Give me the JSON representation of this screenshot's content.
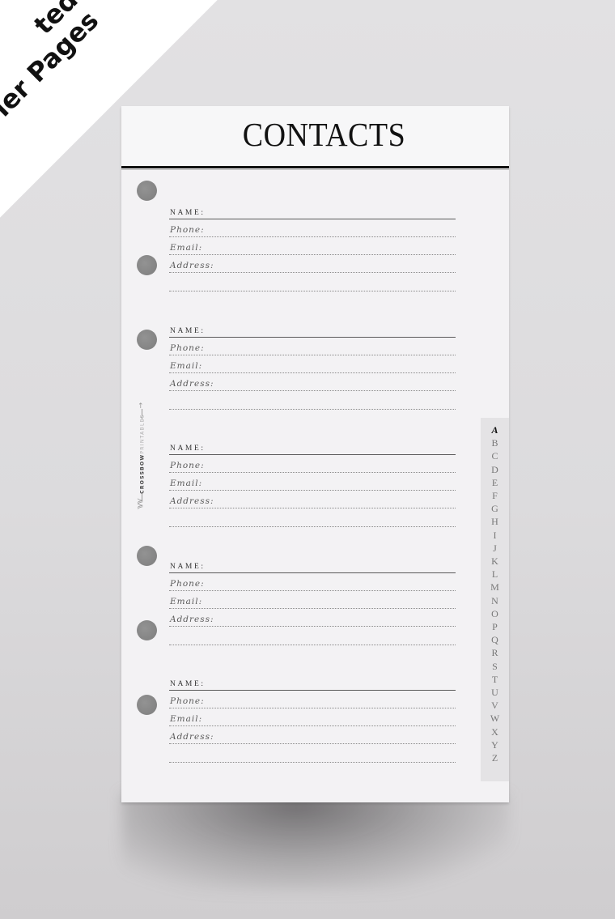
{
  "badge": {
    "line1": "ted",
    "line2": "ler Pages"
  },
  "page": {
    "title": "CONTACTS",
    "entries": [
      {
        "name_label": "NAME:",
        "phone_label": "Phone:",
        "email_label": "Email:",
        "address_label": "Address:"
      },
      {
        "name_label": "NAME:",
        "phone_label": "Phone:",
        "email_label": "Email:",
        "address_label": "Address:"
      },
      {
        "name_label": "NAME:",
        "phone_label": "Phone:",
        "email_label": "Email:",
        "address_label": "Address:"
      },
      {
        "name_label": "NAME:",
        "phone_label": "Phone:",
        "email_label": "Email:",
        "address_label": "Address:"
      },
      {
        "name_label": "NAME:",
        "phone_label": "Phone:",
        "email_label": "Email:",
        "address_label": "Address:"
      }
    ],
    "brand": {
      "bold": "CROSSBOW",
      "light": "PRINTABLES"
    },
    "tabs": {
      "active": "A",
      "letters": [
        "A",
        "B",
        "C",
        "D",
        "E",
        "F",
        "G",
        "H",
        "I",
        "J",
        "K",
        "L",
        "M",
        "N",
        "O",
        "P",
        "Q",
        "R",
        "S",
        "T",
        "U",
        "V",
        "W",
        "X",
        "Y",
        "Z"
      ]
    }
  },
  "colors": {
    "background": "#dcdbdd",
    "paper": "#f3f2f4",
    "hole": "#888888",
    "rule": "#111111",
    "tab_strip": "#e4e3e5"
  }
}
